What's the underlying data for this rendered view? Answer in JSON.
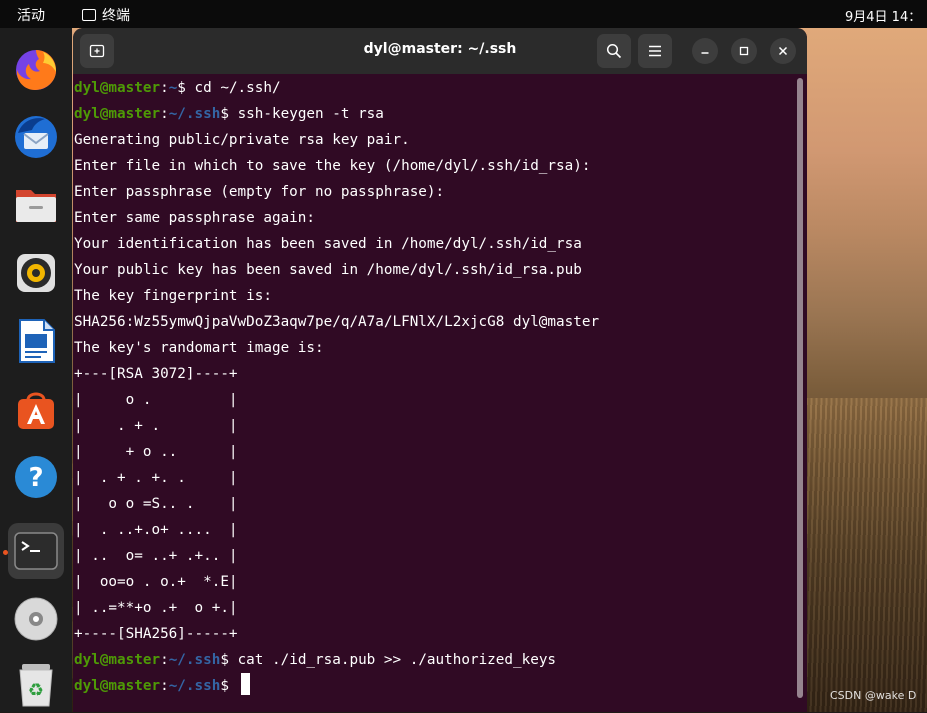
{
  "topbar": {
    "activities": "活动",
    "app_name": "终端",
    "clock": "9月4日 14："
  },
  "dock": {
    "items": [
      {
        "icon": "firefox-icon",
        "label": "Firefox"
      },
      {
        "icon": "thunderbird-icon",
        "label": "Thunderbird"
      },
      {
        "icon": "files-icon",
        "label": "Files"
      },
      {
        "icon": "rhythmbox-icon",
        "label": "Rhythmbox"
      },
      {
        "icon": "libreoffice-writer-icon",
        "label": "LibreOffice Writer"
      },
      {
        "icon": "app-center-icon",
        "label": "Ubuntu Software"
      },
      {
        "icon": "help-icon",
        "label": "Help"
      },
      {
        "icon": "terminal-icon",
        "label": "Terminal"
      },
      {
        "icon": "disc-icon",
        "label": "Disc"
      },
      {
        "icon": "trash-icon",
        "label": "Trash"
      }
    ]
  },
  "terminal": {
    "title": "dyl@master: ~/.ssh",
    "prompt_user": "dyl@master",
    "prompt_colon": ":",
    "prompt_dollar": "$ ",
    "lines": [
      {
        "type": "prompt",
        "path": "~",
        "cmd": "cd ~/.ssh/"
      },
      {
        "type": "prompt",
        "path": "~/.ssh",
        "cmd": "ssh-keygen -t rsa"
      },
      {
        "type": "out",
        "text": "Generating public/private rsa key pair."
      },
      {
        "type": "out",
        "text": "Enter file in which to save the key (/home/dyl/.ssh/id_rsa):"
      },
      {
        "type": "out",
        "text": "Enter passphrase (empty for no passphrase):"
      },
      {
        "type": "out",
        "text": "Enter same passphrase again:"
      },
      {
        "type": "out",
        "text": "Your identification has been saved in /home/dyl/.ssh/id_rsa"
      },
      {
        "type": "out",
        "text": "Your public key has been saved in /home/dyl/.ssh/id_rsa.pub"
      },
      {
        "type": "out",
        "text": "The key fingerprint is:"
      },
      {
        "type": "out",
        "text": "SHA256:Wz55ymwQjpaVwDoZ3aqw7pe/q/A7a/LFNlX/L2xjcG8 dyl@master"
      },
      {
        "type": "out",
        "text": "The key's randomart image is:"
      },
      {
        "type": "out",
        "text": "+---[RSA 3072]----+"
      },
      {
        "type": "out",
        "text": "|     o .         |"
      },
      {
        "type": "out",
        "text": "|    . + .        |"
      },
      {
        "type": "out",
        "text": "|     + o ..      |"
      },
      {
        "type": "out",
        "text": "|  . + . +. .     |"
      },
      {
        "type": "out",
        "text": "|   o o =S.. .    |"
      },
      {
        "type": "out",
        "text": "|  . ..+.o+ ....  |"
      },
      {
        "type": "out",
        "text": "| ..  o= ..+ .+.. |"
      },
      {
        "type": "out",
        "text": "|  oo=o . o.+  *.E|"
      },
      {
        "type": "out",
        "text": "| ..=**+o .+  o +.|"
      },
      {
        "type": "out",
        "text": "+----[SHA256]-----+"
      },
      {
        "type": "prompt",
        "path": "~/.ssh",
        "cmd": "cat ./id_rsa.pub >> ./authorized_keys"
      },
      {
        "type": "prompt",
        "path": "~/.ssh",
        "cmd": "",
        "cursor": true
      }
    ]
  },
  "watermark": "CSDN @wake D",
  "colors": {
    "terminal_bg": "#300a24",
    "prompt_user": "#4e9a06",
    "prompt_path": "#3465a4",
    "header_bg": "#2b2b2b"
  }
}
